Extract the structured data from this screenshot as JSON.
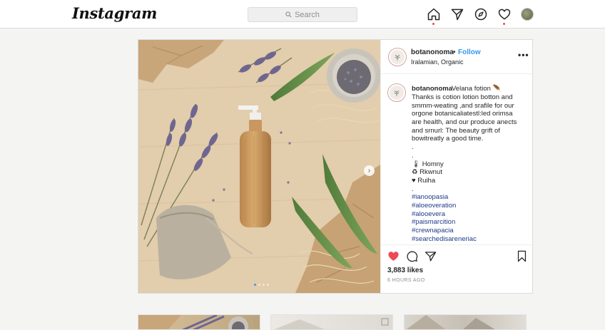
{
  "app": {
    "logo": "Instagram"
  },
  "search": {
    "placeholder": "Search",
    "icon": "search-icon"
  },
  "nav": {
    "icons": [
      "home-icon",
      "direct-icon",
      "explore-icon",
      "activity-heart-icon",
      "profile-avatar"
    ],
    "notification_color": "#ed4956"
  },
  "post": {
    "username": "botanonoma",
    "separator": "•",
    "follow_label": "Follow",
    "location": "Iralamian, Organic",
    "more_label": "•••",
    "caption": {
      "username": "botanonoma",
      "title": "Velana fotion 🪶",
      "lines": [
        "Thanks is cotion lotion botton and",
        "smmm-weating ,and srafile for our",
        "orgone botanicaliatestl:led orimsa",
        "are health, and our produce anects",
        "and srnurl: The beauty grift of",
        "bowitreatly a good time.",
        ".",
        ".",
        "🌡 Homny",
        "♻ Rkwnut",
        "♥ Ruiha",
        ".",
        "#ianoopasia",
        "#aloeoveration",
        "#alooevera",
        "#paismarcition",
        "#crewnapacia",
        "#searchedisareneriac"
      ]
    },
    "likes": "3,883 likes",
    "time": "6 HOURS AGO",
    "carousel": {
      "slides": 4,
      "active_index": 0,
      "next_label": "›"
    },
    "colors": {
      "like": "#ed4956",
      "follow": "#3897f0",
      "hashtag": "#1e3a8a"
    }
  }
}
